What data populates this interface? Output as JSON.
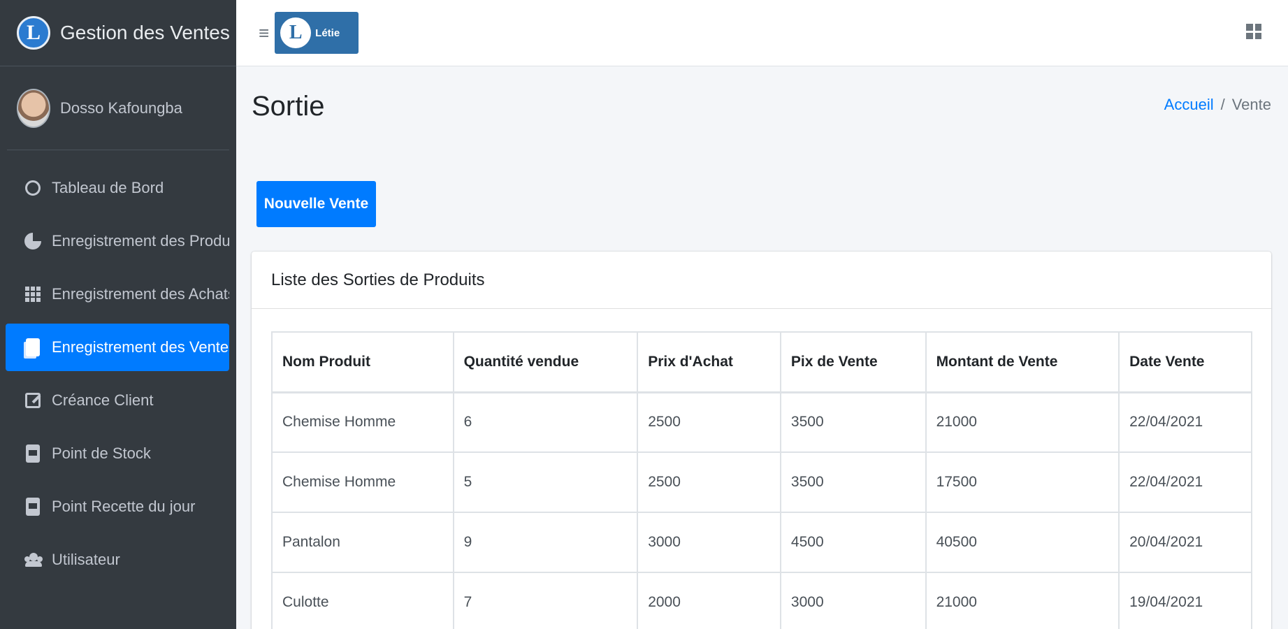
{
  "brand": {
    "logo_letter": "L",
    "title": "Gestion des Ventes"
  },
  "user": {
    "name": "Dosso Kafoungba"
  },
  "sidebar": {
    "items": [
      {
        "label": "Tableau de Bord",
        "icon": "circle-icon"
      },
      {
        "label": "Enregistrement des Produits",
        "icon": "pie-chart-icon"
      },
      {
        "label": "Enregistrement des Achats",
        "icon": "grid-icon"
      },
      {
        "label": "Enregistrement des Ventes",
        "icon": "copy-icon",
        "active": true
      },
      {
        "label": "Créance Client",
        "icon": "edit-icon"
      },
      {
        "label": "Point de Stock",
        "icon": "sim-card-icon"
      },
      {
        "label": "Point Recette du jour",
        "icon": "sim-card-icon"
      },
      {
        "label": "Utilisateur",
        "icon": "users-icon"
      }
    ]
  },
  "topbar": {
    "menu_glyph": "≡",
    "logo_letter": "L",
    "logo_text": "Létie"
  },
  "header": {
    "title": "Sortie",
    "breadcrumb": {
      "home": "Accueil",
      "separator": "/",
      "current": "Vente"
    }
  },
  "actions": {
    "new_sale_label": "Nouvelle Vente"
  },
  "card": {
    "title": "Liste des Sorties de Produits",
    "table": {
      "columns": [
        "Nom Produit",
        "Quantité vendue",
        "Prix d'Achat",
        "Pix de Vente",
        "Montant de Vente",
        "Date Vente"
      ],
      "rows": [
        [
          "Chemise Homme",
          "6",
          "2500",
          "3500",
          "21000",
          "22/04/2021"
        ],
        [
          "Chemise Homme",
          "5",
          "2500",
          "3500",
          "17500",
          "22/04/2021"
        ],
        [
          "Pantalon",
          "9",
          "3000",
          "4500",
          "40500",
          "20/04/2021"
        ],
        [
          "Culotte",
          "7",
          "2000",
          "3000",
          "21000",
          "19/04/2021"
        ]
      ]
    }
  },
  "colors": {
    "sidebar_bg": "#343a40",
    "accent": "#007bff",
    "content_bg": "#f4f6f9"
  }
}
